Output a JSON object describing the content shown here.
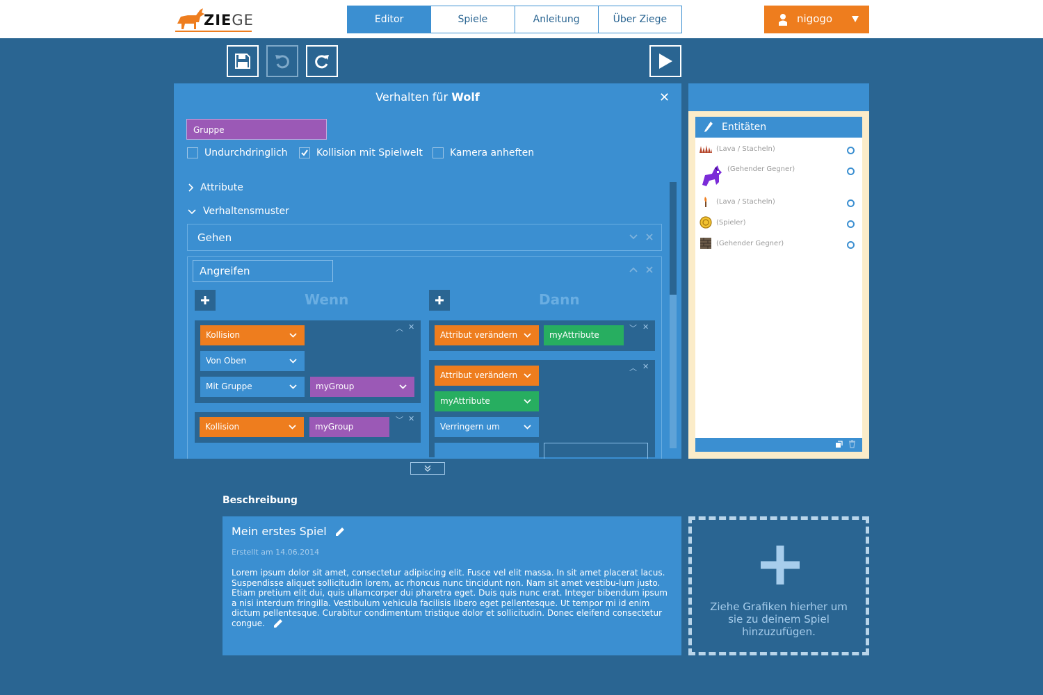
{
  "brand": {
    "logo_bold": "ZIE",
    "logo_rest": "GE"
  },
  "nav": {
    "tabs": [
      "Editor",
      "Spiele",
      "Anleitung",
      "Über Ziege"
    ],
    "active": "Editor"
  },
  "user": {
    "name": "nigogo"
  },
  "toolbar": {
    "save": "save-icon",
    "undo": "undo-icon",
    "redo": "redo-icon",
    "play": "play-icon"
  },
  "behaviour_panel": {
    "title_prefix": "Verhalten für",
    "title_entity": "Wolf",
    "group_value": "Gruppe",
    "checkboxes": [
      {
        "label": "Undurchdringlich",
        "checked": false
      },
      {
        "label": "Kollision mit Spielwelt",
        "checked": true
      },
      {
        "label": "Kamera anheften",
        "checked": false
      }
    ],
    "sections": {
      "attributes": "Attribute",
      "patterns": "Verhaltensmuster"
    },
    "behaviours": {
      "collapsed": {
        "name": "Gehen"
      },
      "open": {
        "name": "Angreifen",
        "when_label": "Wenn",
        "then_label": "Dann",
        "conditions": [
          {
            "type": "Kollision",
            "direction": "Von Oben",
            "with": "Mit Gruppe",
            "group": "myGroup"
          },
          {
            "type": "Kollision",
            "group": "myGroup"
          }
        ],
        "actions": [
          {
            "type": "Attribut verändern",
            "attribute": "myAttribute"
          },
          {
            "type": "Attribut verändern",
            "attribute": "myAttribute",
            "operation": "Verringern um"
          }
        ]
      }
    }
  },
  "entities": {
    "title": "Entitäten",
    "items": [
      {
        "label": "(Lava / Stacheln)",
        "icon": "spikes-icon"
      },
      {
        "label": "(Gehender Gegner)",
        "icon": "wolf-icon"
      },
      {
        "label": "(Lava / Stacheln)",
        "icon": "torch-icon"
      },
      {
        "label": "(Spieler)",
        "icon": "coin-icon"
      },
      {
        "label": "(Gehender Gegner)",
        "icon": "brick-icon"
      }
    ]
  },
  "description": {
    "label": "Beschreibung",
    "title": "Mein erstes Spiel",
    "date": "Erstellt am 14.06.2014",
    "text": "Lorem ipsum dolor sit amet, consectetur adipiscing elit. Fusce vel elit massa. In sit amet placerat lacus. Suspendisse aliquet sollicitudin lorem, ac rhoncus nunc tincidunt non. Nam sit amet vestibu-lum justo. Etiam pretium elit dui, quis ullamcorper dui pharetra eget. Duis quis nunc erat. Integer bibendum ipsum a nisi interdum fringilla. Vestibulum vehicula facilisis libero eget pellentesque. Ut tempor mi id enim dictum pellentesque. Curabitur condimentum tristique dolor et sollicitudin. Donec eleifend consectetur congue."
  },
  "dropzone": {
    "text": "Ziehe Grafiken hierher um sie zu deinem Spiel hinzuzufügen."
  },
  "colors": {
    "background": "#2a6592",
    "panel": "#3b8fd1",
    "orange": "#ee7d1e",
    "purple": "#9b59b6",
    "green": "#27ae60"
  }
}
